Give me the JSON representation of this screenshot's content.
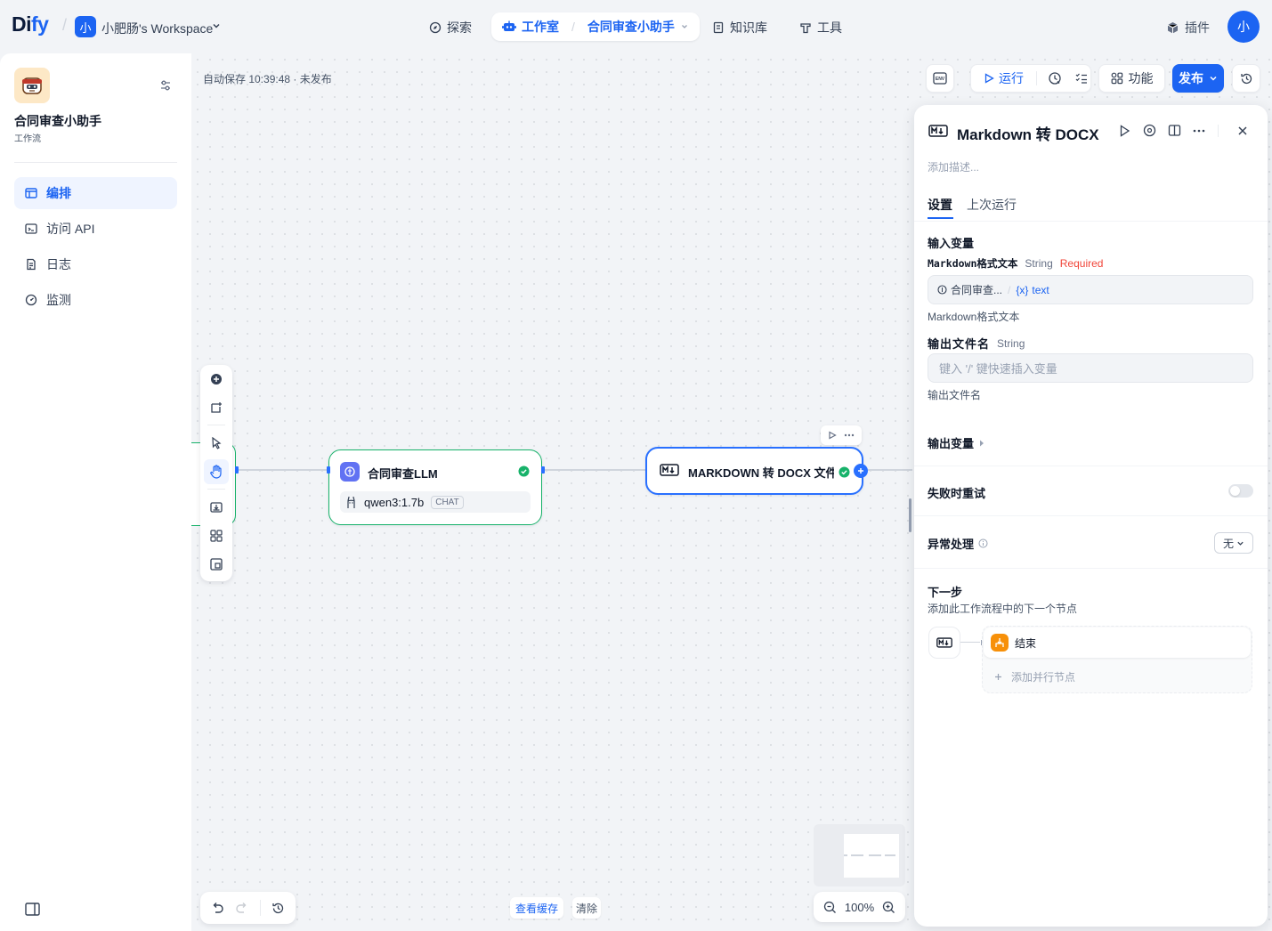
{
  "topbar": {
    "logo_main": "Di",
    "logo_accent": "fy",
    "workspace_avatar": "小",
    "workspace_name": "小肥肠's Workspace",
    "nav": {
      "explore": "探索",
      "studio": "工作室",
      "app": "合同审查小助手",
      "knowledge": "知识库",
      "tools": "工具"
    },
    "plugins": "插件",
    "user_avatar": "小"
  },
  "sidebar": {
    "app_name": "合同审查小助手",
    "app_type": "工作流",
    "items": [
      {
        "label": "编排",
        "icon": "layout-icon",
        "active": true
      },
      {
        "label": "访问 API",
        "icon": "terminal-icon",
        "active": false
      },
      {
        "label": "日志",
        "icon": "log-icon",
        "active": false
      },
      {
        "label": "监测",
        "icon": "monitor-icon",
        "active": false
      }
    ]
  },
  "canvas": {
    "autosave": "自动保存 10:39:48 · 未发布",
    "env_label": "ENV",
    "run": "运行",
    "features": "功能",
    "publish": "发布",
    "llm_node": {
      "title": "合同审查LLM",
      "model": "qwen3:1.7b",
      "badge": "CHAT"
    },
    "md_node": {
      "title": "MARKDOWN 转 DOCX 文件"
    },
    "view_cache": "查看缓存",
    "clear": "清除",
    "zoom": "100%"
  },
  "panel": {
    "title": "Markdown 转 DOCX",
    "description_placeholder": "添加描述...",
    "tabs": {
      "settings": "设置",
      "last_run": "上次运行"
    },
    "input_vars": "输入变量",
    "var1": {
      "name": "Markdown格式文本",
      "type": "String",
      "required": "Required",
      "source_node": "合同审查...",
      "source_var": "text",
      "hint": "Markdown格式文本"
    },
    "var2": {
      "name": "输出文件名",
      "type": "String",
      "placeholder": "键入 '/' 键快速插入变量",
      "hint": "输出文件名"
    },
    "output_vars": "输出变量",
    "retry": "失败时重试",
    "error_handling": "异常处理",
    "error_value": "无",
    "next_step": "下一步",
    "next_step_desc": "添加此工作流程中的下一个节点",
    "end_node": "结束",
    "add_parallel": "添加并行节点"
  },
  "colors": {
    "accent": "#1c64f2",
    "success": "#17b26a",
    "required": "#f04438",
    "end_node": "#f79009",
    "llm_icon": "#6172f3"
  }
}
